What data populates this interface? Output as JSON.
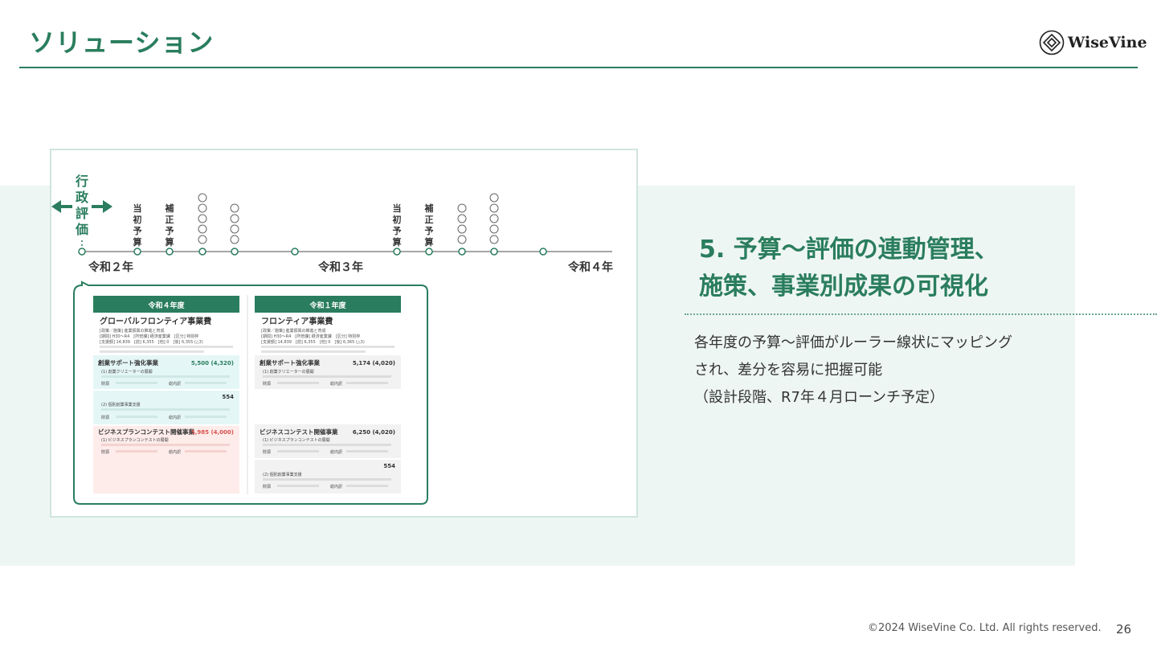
{
  "header": {
    "title": "ソリューション",
    "logo_text": "WiseVine"
  },
  "timeline": {
    "gyosei": [
      "行",
      "政",
      "評",
      "価"
    ],
    "markers": [
      [
        "当",
        "初",
        "予",
        "算"
      ],
      [
        "補",
        "正",
        "予",
        "算"
      ],
      [
        "当",
        "初",
        "予",
        "算"
      ],
      [
        "補",
        "正",
        "予",
        "算"
      ]
    ],
    "years": [
      "令和２年",
      "令和３年",
      "令和４年"
    ]
  },
  "left_panel": {
    "header": "令和４年度",
    "title": "グローバルフロンティア事業費",
    "meta": [
      "[政策／施策] 産業振興の推進と育成",
      "[期間] H30〜R4　[所管課] 経済産業課　[区分] 特別枠",
      "[支援額] 14,839　[前] 6,355　[他] 0　[後] 6,355 (△3)"
    ],
    "items": [
      {
        "title": "創業サポート強化事業",
        "amount": "5,500 (4,320)",
        "sub": "(1) 創業クリエーターの展開",
        "label_a": "財源",
        "label_b": "総内訳"
      },
      {
        "title": "",
        "amount": "554",
        "sub": "(2) 個別創業事業支援",
        "label_a": "財源",
        "label_b": "総内訳"
      },
      {
        "title": "ビジネスプランコンテスト開催事業",
        "amount": "5,985 (4,000)",
        "sub": "(1) ビジネスプランコンテストの展開",
        "label_a": "財源",
        "label_b": "総内訳"
      }
    ]
  },
  "right_panel": {
    "header": "令和１年度",
    "title": "フロンティア事業費",
    "meta": [
      "[政策／施策] 産業振興の推進と育成",
      "[期間] H30〜R4　[所管課] 経済産業課　[区分] 特別枠",
      "[支援額] 14,839　[前] 6,355　[他] 0　[後] 6,365 (△3)"
    ],
    "items": [
      {
        "title": "創業サポート強化事業",
        "amount": "5,174 (4,020)",
        "sub": "(1) 創業クリエーターの展開",
        "label_a": "財源",
        "label_b": "総内訳"
      },
      {
        "title": "ビジネスコンテスト開催事業",
        "amount": "6,250 (4,020)",
        "sub": "(1) ビジネスプランコンテストの展開",
        "label_a": "財源",
        "label_b": "総内訳"
      },
      {
        "title": "",
        "amount": "554",
        "sub": "(2) 個別創業事業支援",
        "label_a": "財源",
        "label_b": "総内訳"
      }
    ]
  },
  "main": {
    "heading_line1": "5. 予算〜評価の連動管理、",
    "heading_line2": "施策、事業別成果の可視化",
    "desc_line1": "各年度の予算〜評価がルーラー線状にマッピング",
    "desc_line2": "され、差分を容易に把握可能",
    "desc_line3": "（設計段階、R7年４月ローンチ予定）"
  },
  "footer": {
    "copyright": "©2024 WiseVine Co. Ltd. All rights reserved.",
    "page": "26"
  },
  "colors": {
    "brand_green": "#2a7d5e",
    "band_bg": "#eef6f3",
    "highlight_cyan": "#e4f7f6",
    "highlight_pink": "#fdecea",
    "accent_red": "#d9534f"
  }
}
